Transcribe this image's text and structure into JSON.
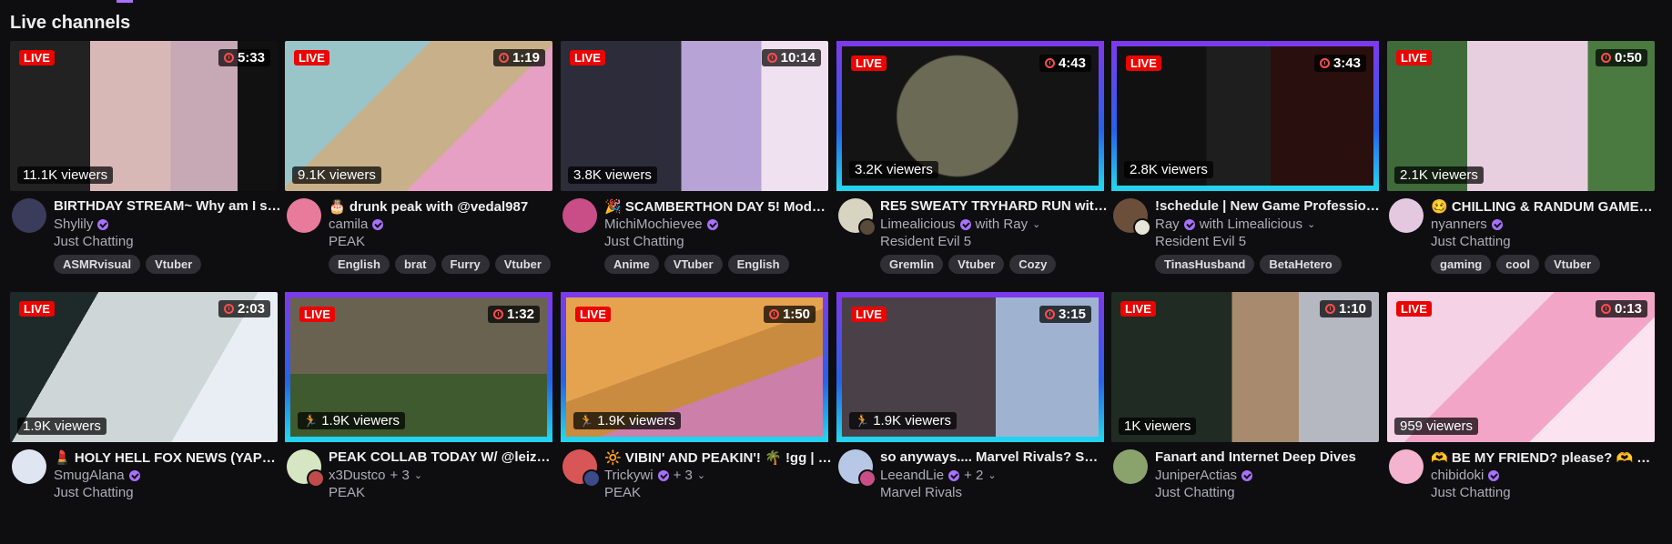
{
  "section_title": "Live channels",
  "live_badge": "LIVE",
  "cards": [
    {
      "title": "BIRTHDAY STREAM~ Why am I sic...",
      "channel": "Shylily",
      "collab": "",
      "category": "Just Chatting",
      "duration": "5:33",
      "viewers": "11.1K viewers",
      "tags": [
        "ASMRvisual",
        "Vtuber"
      ]
    },
    {
      "title": "🎂 drunk peak with @vedal987",
      "channel": "camila",
      "collab": "",
      "category": "PEAK",
      "duration": "1:19",
      "viewers": "9.1K viewers",
      "tags": [
        "English",
        "brat",
        "Furry",
        "Vtuber"
      ]
    },
    {
      "title": "🎉 SCAMBERTHON DAY 5! Modca...",
      "channel": "MichiMochievee",
      "collab": "",
      "category": "Just Chatting",
      "duration": "10:14",
      "viewers": "3.8K viewers",
      "tags": [
        "Anime",
        "VTuber",
        "English"
      ]
    },
    {
      "title": "RE5 SWEATY TRYHARD RUN with ...",
      "channel": "Limealicious",
      "collab": "with Ray",
      "category": "Resident Evil 5",
      "duration": "4:43",
      "viewers": "3.2K viewers",
      "tags": [
        "Gremlin",
        "Vtuber",
        "Cozy"
      ]
    },
    {
      "title": "!schedule | New Game Profession...",
      "channel": "Ray",
      "collab": "with Limealicious",
      "category": "Resident Evil 5",
      "duration": "3:43",
      "viewers": "2.8K viewers",
      "tags": [
        "TinasHusband",
        "BetaHetero"
      ]
    },
    {
      "title": "🥴 CHILLING & RANDUM GAMEZ X...",
      "channel": "nyanners",
      "collab": "",
      "category": "Just Chatting",
      "duration": "0:50",
      "viewers": "2.1K viewers",
      "tags": [
        "gaming",
        "cool",
        "Vtuber"
      ]
    },
    {
      "title": "💄 HOLY HELL FOX NEWS (YAPPA...",
      "channel": "SmugAlana",
      "collab": "",
      "category": "Just Chatting",
      "duration": "2:03",
      "viewers": "1.9K viewers",
      "tags": []
    },
    {
      "title": "PEAK COLLAB TODAY W/ @leizus...",
      "channel": "x3Dustco",
      "collab": "+ 3",
      "category": "PEAK",
      "duration": "1:32",
      "viewers": "1.9K viewers",
      "tags": []
    },
    {
      "title": "🔆 VIBIN' AND PEAKIN'! 🌴 !gg | !...",
      "channel": "Trickywi",
      "collab": "+ 3",
      "category": "PEAK",
      "duration": "1:50",
      "viewers": "1.9K viewers",
      "tags": []
    },
    {
      "title": "so anyways.... Marvel Rivals? SNO...",
      "channel": "LeeandLie",
      "collab": "+ 2",
      "category": "Marvel Rivals",
      "duration": "3:15",
      "viewers": "1.9K viewers",
      "tags": []
    },
    {
      "title": "Fanart and Internet Deep Dives",
      "channel": "JuniperActias",
      "collab": "",
      "category": "Just Chatting",
      "duration": "1:10",
      "viewers": "1K viewers",
      "tags": []
    },
    {
      "title": "🫶 BE MY FRIEND? please? 🫶 GR...",
      "channel": "chibidoki",
      "collab": "",
      "category": "Just Chatting",
      "duration": "0:13",
      "viewers": "959 viewers",
      "tags": []
    }
  ]
}
